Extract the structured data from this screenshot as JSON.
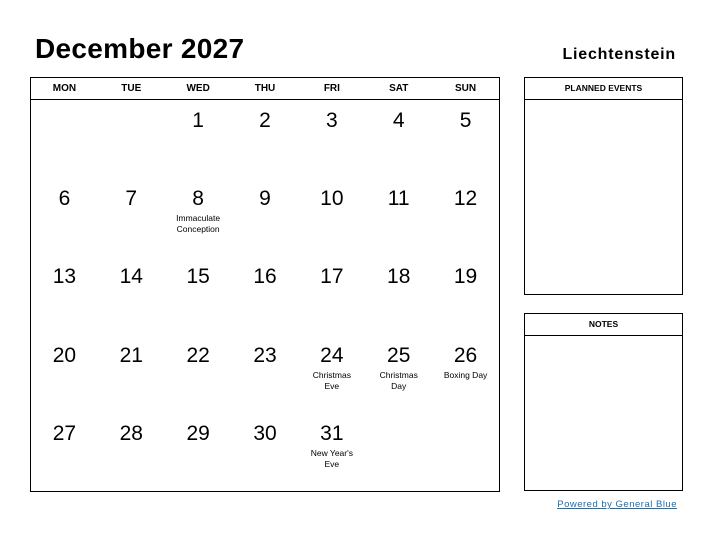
{
  "header": {
    "title": "December 2027",
    "country": "Liechtenstein"
  },
  "weekdays": [
    "MON",
    "TUE",
    "WED",
    "THU",
    "FRI",
    "SAT",
    "SUN"
  ],
  "weeks": [
    [
      {
        "day": ""
      },
      {
        "day": ""
      },
      {
        "day": "1"
      },
      {
        "day": "2"
      },
      {
        "day": "3"
      },
      {
        "day": "4"
      },
      {
        "day": "5"
      }
    ],
    [
      {
        "day": "6"
      },
      {
        "day": "7"
      },
      {
        "day": "8",
        "holiday": "Immaculate Conception"
      },
      {
        "day": "9"
      },
      {
        "day": "10"
      },
      {
        "day": "11"
      },
      {
        "day": "12"
      }
    ],
    [
      {
        "day": "13"
      },
      {
        "day": "14"
      },
      {
        "day": "15"
      },
      {
        "day": "16"
      },
      {
        "day": "17"
      },
      {
        "day": "18"
      },
      {
        "day": "19"
      }
    ],
    [
      {
        "day": "20"
      },
      {
        "day": "21"
      },
      {
        "day": "22"
      },
      {
        "day": "23"
      },
      {
        "day": "24",
        "holiday": "Christmas Eve"
      },
      {
        "day": "25",
        "holiday": "Christmas Day"
      },
      {
        "day": "26",
        "holiday": "Boxing Day"
      }
    ],
    [
      {
        "day": "27"
      },
      {
        "day": "28"
      },
      {
        "day": "29"
      },
      {
        "day": "30"
      },
      {
        "day": "31",
        "holiday": "New Year's Eve"
      },
      {
        "day": ""
      },
      {
        "day": ""
      }
    ]
  ],
  "panels": {
    "planned_events": "PLANNED EVENTS",
    "notes": "NOTES"
  },
  "footer": {
    "powered_by": "Powered by General Blue",
    "link_color": "#1a6fb5"
  }
}
